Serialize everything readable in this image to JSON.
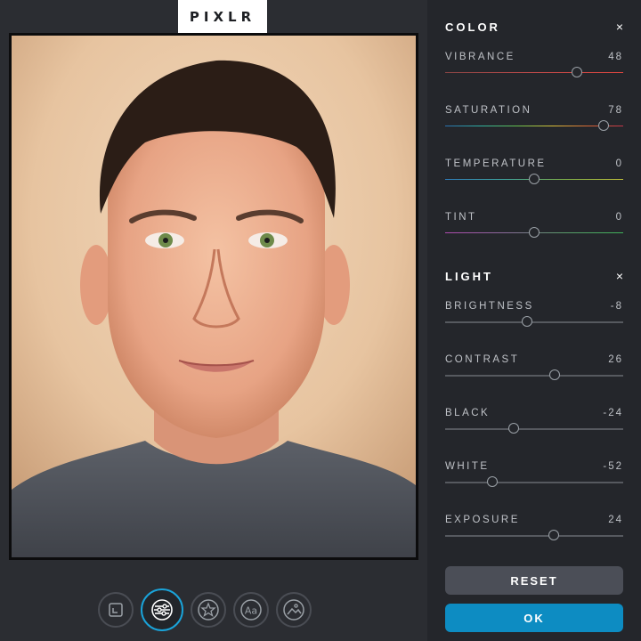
{
  "app": {
    "logo": "PIXLR"
  },
  "toolbar": {
    "tools": [
      {
        "name": "crop-tool-button",
        "icon": "crop-icon",
        "active": false
      },
      {
        "name": "adjust-tool-button",
        "icon": "sliders-icon",
        "active": true
      },
      {
        "name": "effects-tool-button",
        "icon": "star-icon",
        "active": false
      },
      {
        "name": "text-tool-button",
        "icon": "text-icon",
        "active": false
      },
      {
        "name": "overlay-tool-button",
        "icon": "image-icon",
        "active": false
      }
    ]
  },
  "panel": {
    "color": {
      "title": "COLOR",
      "close": "×",
      "items": [
        {
          "label": "VIBRANCE",
          "value": "48",
          "level": 0.74,
          "gradient": "vibrance"
        },
        {
          "label": "SATURATION",
          "value": "78",
          "level": 0.89,
          "gradient": "saturation"
        },
        {
          "label": "TEMPERATURE",
          "value": "0",
          "level": 0.5,
          "gradient": "temperature"
        },
        {
          "label": "TINT",
          "value": "0",
          "level": 0.5,
          "gradient": "tint"
        }
      ]
    },
    "light": {
      "title": "LIGHT",
      "close": "×",
      "items": [
        {
          "label": "BRIGHTNESS",
          "value": "-8",
          "level": 0.46
        },
        {
          "label": "CONTRAST",
          "value": "26",
          "level": 0.615
        },
        {
          "label": "BLACK",
          "value": "-24",
          "level": 0.385
        },
        {
          "label": "WHITE",
          "value": "-52",
          "level": 0.265
        },
        {
          "label": "EXPOSURE",
          "value": "24",
          "level": 0.61
        }
      ]
    },
    "reset_label": "RESET",
    "ok_label": "OK"
  },
  "colors": {
    "accent": "#1aa3d9",
    "ok": "#0d8cc2",
    "panel": "#24262b",
    "reset": "#4b4e57"
  }
}
